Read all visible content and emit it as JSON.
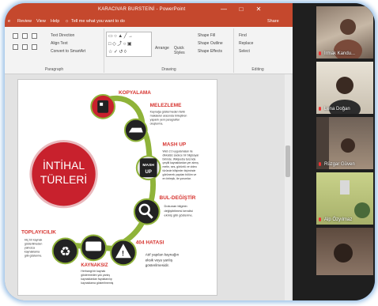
{
  "app": {
    "window_title": "KARACIVAR BURSTEİNİ - PowerPoint",
    "controls": [
      "—",
      "□",
      "✕"
    ],
    "menu": [
      "e",
      "Review",
      "View",
      "Help",
      "Tell me what you want to do"
    ],
    "menu_icon": "lightbulb-icon",
    "share": "Share",
    "ribbon": {
      "paragraph_label": "Paragraph",
      "drawing_label": "Drawing",
      "editing_label": "Editing",
      "text_direction": "Text Direction",
      "align_text": "Align Text",
      "convert_smartart": "Convert to SmartArt",
      "arrange": "Arrange",
      "quick_styles": "Quick Styles",
      "shape_fill": "Shape Fill",
      "shape_outline": "Shape Outline",
      "shape_effects": "Shape Effects",
      "find": "Find",
      "replace": "Replace",
      "select": "Select"
    }
  },
  "slide": {
    "center_title_line1": "İNTİHAL",
    "center_title_line2": "TÜRLERİ",
    "items": [
      {
        "title": "KOPYALAMA",
        "body": ""
      },
      {
        "title": "MELEZLEME",
        "body": [
          "Kaynağa göstermeden farklı",
          "makaleler arasında birleştiren",
          "yapanlı yeni paragraflar",
          "oluşturma."
        ]
      },
      {
        "title": "MASH UP",
        "icon_label": [
          "MASH",
          "UP"
        ],
        "body": [
          "Web 2.0 uygulamaları ile",
          "dikkatsiz sadece bir bilgisayar",
          "birimde. Wikipedia tarzında",
          "çeşitli kaynaklardan yer almış",
          "metin, ses, görüntü ve video",
          "türünde bilişimler biçiminde",
          "görünerek yapılan bölüm ve",
          "en birleşik, ile yorumlar."
        ]
      },
      {
        "title": "BUL-DEĞİŞTİR",
        "body": [
          "Dokunan bilginin",
          "değiştirilmesi kendisi",
          "ekmiş gibi gösterme."
        ]
      },
      {
        "title": "404 HATASI",
        "body": [
          "Atıf yapılan kaynağın",
          "eksik veya yanlış",
          "gösterilmesidir."
        ]
      },
      {
        "title": "KAYNAKSIZ",
        "body": [
          "Herhangi bir kaynak",
          "göstermeden yok yanlış",
          "kaynaklardan faydalanılıp",
          "kaynaklama gösterilmemiş"
        ]
      },
      {
        "title": "TOPLAYICILIK",
        "body": [
          "Hiç bir kaynak",
          "gösterilmeden",
          "yalnızca",
          "kaynaklama",
          "gibi gösterme."
        ]
      }
    ]
  },
  "participants": [
    {
      "name": "Irmak Kandu..."
    },
    {
      "name": "Lena Doğan"
    },
    {
      "name": "Rüzgar Güven"
    },
    {
      "name": "Alp Özyılmaz"
    },
    {
      "name": ""
    }
  ],
  "colors": {
    "accent": "#c5482d",
    "title_red": "#d6322d",
    "bubble_red": "#c8212d",
    "ring": "#8fb339"
  }
}
